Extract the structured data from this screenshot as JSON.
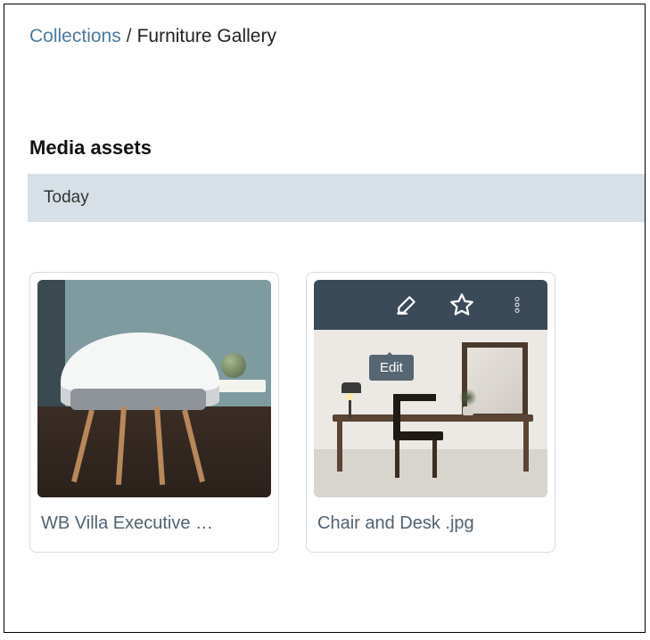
{
  "breadcrumb": {
    "root": "Collections",
    "separator": "/",
    "current": "Furniture Gallery"
  },
  "section": {
    "title": "Media assets"
  },
  "group": {
    "label": "Today"
  },
  "toolbar": {
    "edit_tooltip": "Edit",
    "icons": {
      "edit": "edit-icon",
      "favorite": "star-icon",
      "more": "more-vertical-icon"
    }
  },
  "assets": [
    {
      "caption": "WB Villa Executive …"
    },
    {
      "caption": "Chair and Desk .jpg"
    }
  ],
  "colors": {
    "link": "#4a7aa6",
    "group_header_bg": "#d7e0e6",
    "toolbar_bg": "#3a4a59",
    "tooltip_bg": "#566672"
  }
}
